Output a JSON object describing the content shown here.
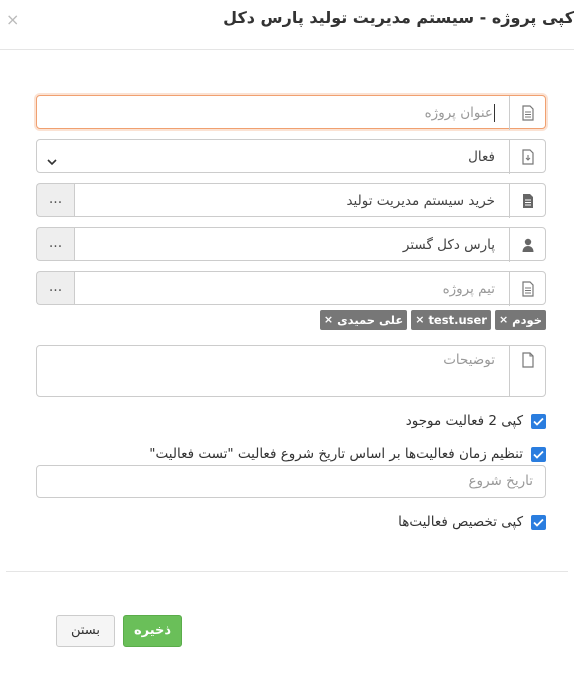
{
  "header": {
    "title": "کپی پروژه - سیستم مدیریت تولید پارس دکل",
    "close_symbol": "×"
  },
  "form": {
    "project_title": {
      "placeholder": "عنوان پروژه",
      "icon": "document-icon"
    },
    "status": {
      "selected": "فعال",
      "icon": "status-file-icon"
    },
    "product": {
      "value": "خرید سیستم مدیریت تولید",
      "button": "...",
      "icon": "document-icon"
    },
    "manager": {
      "value": "پارس دکل گستر",
      "button": "...",
      "icon": "user-icon"
    },
    "team": {
      "placeholder": "تیم پروژه",
      "button": "...",
      "icon": "document-icon"
    },
    "team_tags": [
      {
        "label": "خودم",
        "remove": "×"
      },
      {
        "label": "test.user",
        "remove": "×"
      },
      {
        "label": "علی حمیدی",
        "remove": "×"
      }
    ],
    "description": {
      "placeholder": "توضیحات",
      "icon": "file-icon"
    },
    "copy_activities": {
      "label": "کپی 2 فعالیت موجود",
      "checked": true
    },
    "adjust_times": {
      "label": "تنظیم زمان فعالیت‌ها بر اساس تاریخ شروع فعالیت \"تست فعالیت\"",
      "checked": true
    },
    "start_date": {
      "placeholder": "تاریخ شروع"
    },
    "copy_assignments": {
      "label": "کپی تخصیص فعالیت‌ها",
      "checked": true
    }
  },
  "footer": {
    "save_label": "ذخیره",
    "close_label": "بستن"
  },
  "colors": {
    "primary": "#2a7ddf",
    "success": "#6abf59",
    "tag": "#777777",
    "focus": "#f0a070"
  }
}
